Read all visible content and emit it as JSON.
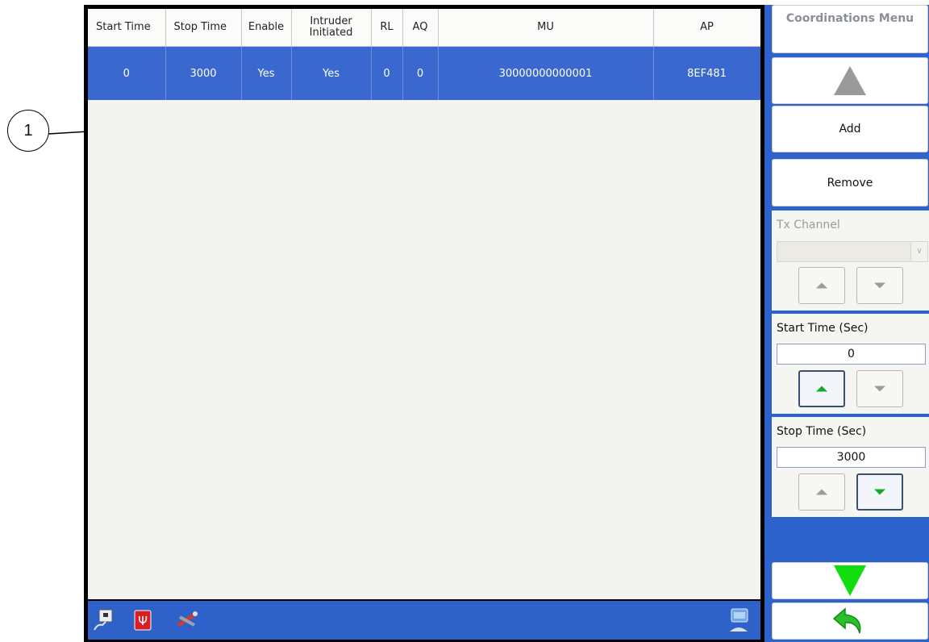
{
  "callout": {
    "label": "1"
  },
  "table": {
    "headers": [
      "Start Time",
      "Stop Time",
      "Enable",
      "Intruder Initiated",
      "RL",
      "AQ",
      "MU",
      "AP"
    ],
    "rows": [
      [
        "0",
        "3000",
        "Yes",
        "Yes",
        "0",
        "0",
        "30000000000001",
        "8EF481"
      ]
    ]
  },
  "sidebar": {
    "menu_title": "Coordinations Menu",
    "add_label": "Add",
    "remove_label": "Remove",
    "tx_channel_label": "Tx Channel",
    "tx_channel_value": "",
    "start_time_label": "Start Time (Sec)",
    "start_time_value": "0",
    "stop_time_label": "Stop Time (Sec)",
    "stop_time_value": "3000"
  },
  "taskbar": {
    "icons": [
      "network-icon",
      "usb-icon",
      "tools-icon",
      "keyboard-icon"
    ]
  },
  "colors": {
    "selection": "#3a66cc",
    "taskbar": "#2e62c9",
    "accent_green": "#11dd11",
    "disabled_grey": "#9a9a9a"
  },
  "icons": {
    "scroll_up": "scroll-up-arrow-icon",
    "scroll_down": "scroll-down-arrow-icon",
    "back": "back-arrow-icon"
  }
}
